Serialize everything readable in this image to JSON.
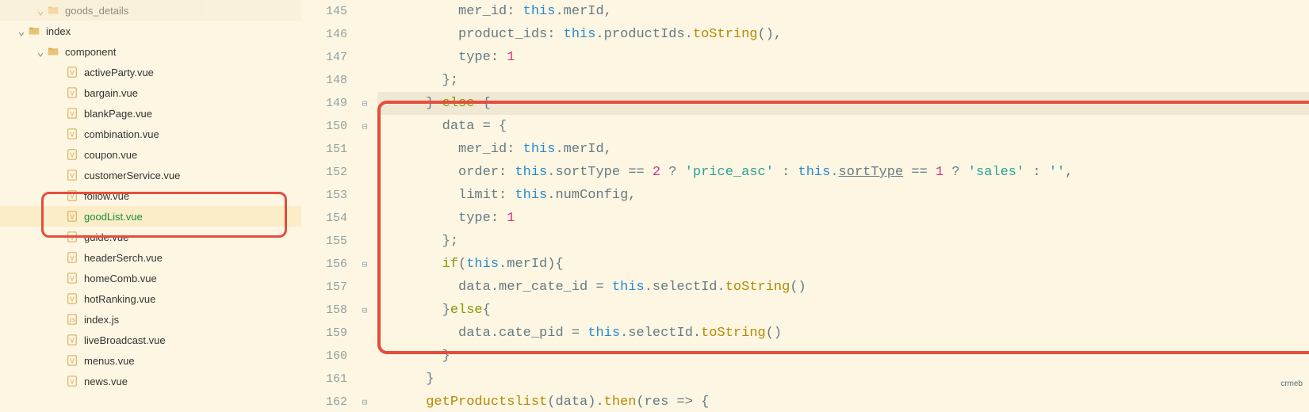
{
  "tree": [
    {
      "label": "goods_details",
      "type": "folder",
      "indent": 2,
      "expanded": true,
      "dim": true
    },
    {
      "label": "index",
      "type": "folder",
      "indent": 1,
      "expanded": true
    },
    {
      "label": "component",
      "type": "folder",
      "indent": 2,
      "expanded": true
    },
    {
      "label": "activeParty.vue",
      "type": "vue",
      "indent": 3
    },
    {
      "label": "bargain.vue",
      "type": "vue",
      "indent": 3
    },
    {
      "label": "blankPage.vue",
      "type": "vue",
      "indent": 3
    },
    {
      "label": "combination.vue",
      "type": "vue",
      "indent": 3
    },
    {
      "label": "coupon.vue",
      "type": "vue",
      "indent": 3
    },
    {
      "label": "customerService.vue",
      "type": "vue",
      "indent": 3
    },
    {
      "label": "follow.vue",
      "type": "vue",
      "indent": 3
    },
    {
      "label": "goodList.vue",
      "type": "vue",
      "indent": 3,
      "selected": true
    },
    {
      "label": "guide.vue",
      "type": "vue",
      "indent": 3
    },
    {
      "label": "headerSerch.vue",
      "type": "vue",
      "indent": 3
    },
    {
      "label": "homeComb.vue",
      "type": "vue",
      "indent": 3
    },
    {
      "label": "hotRanking.vue",
      "type": "vue",
      "indent": 3
    },
    {
      "label": "index.js",
      "type": "js",
      "indent": 3
    },
    {
      "label": "liveBroadcast.vue",
      "type": "vue",
      "indent": 3
    },
    {
      "label": "menus.vue",
      "type": "vue",
      "indent": 3
    },
    {
      "label": "news.vue",
      "type": "vue",
      "indent": 3
    }
  ],
  "lines": {
    "start": 145,
    "rows": [
      {
        "n": 145,
        "fold": "",
        "hl": false
      },
      {
        "n": 146,
        "fold": "",
        "hl": false
      },
      {
        "n": 147,
        "fold": "",
        "hl": false
      },
      {
        "n": 148,
        "fold": "",
        "hl": false
      },
      {
        "n": 149,
        "fold": "⊟",
        "hl": true
      },
      {
        "n": 150,
        "fold": "⊟",
        "hl": false
      },
      {
        "n": 151,
        "fold": "",
        "hl": false
      },
      {
        "n": 152,
        "fold": "",
        "hl": false
      },
      {
        "n": 153,
        "fold": "",
        "hl": false
      },
      {
        "n": 154,
        "fold": "",
        "hl": false
      },
      {
        "n": 155,
        "fold": "",
        "hl": false
      },
      {
        "n": 156,
        "fold": "⊟",
        "hl": false
      },
      {
        "n": 157,
        "fold": "",
        "hl": false
      },
      {
        "n": 158,
        "fold": "⊟",
        "hl": false
      },
      {
        "n": 159,
        "fold": "",
        "hl": false
      },
      {
        "n": 160,
        "fold": "",
        "hl": false
      },
      {
        "n": 161,
        "fold": "",
        "hl": false
      },
      {
        "n": 162,
        "fold": "⊟",
        "hl": false
      }
    ]
  },
  "code": {
    "l145_pad": "          ",
    "l145_key": "mer_id: ",
    "l145_this": "this",
    "l145_rest": ".merId,",
    "l146_pad": "          ",
    "l146_key": "product_ids: ",
    "l146_this": "this",
    "l146_mid": ".productIds.",
    "l146_fn": "toString",
    "l146_end": "(),",
    "l147_pad": "          ",
    "l147_key": "type: ",
    "l147_num": "1",
    "l148_pad": "        ",
    "l148_t": "};",
    "l149_pad": "      ",
    "l149_brace": "} ",
    "l149_else": "else",
    "l149_brace2": " {",
    "l150_pad": "        ",
    "l150_t": "data = {",
    "l151_pad": "          ",
    "l151_key": "mer_id: ",
    "l151_this": "this",
    "l151_rest": ".merId,",
    "l152_pad": "          ",
    "l152_key": "order: ",
    "l152_this1": "this",
    "l152_m1": ".sortType == ",
    "l152_n1": "2",
    "l152_m2": " ? ",
    "l152_s1": "'price_asc'",
    "l152_m3": " : ",
    "l152_this2": "this",
    "l152_m4": ".",
    "l152_u": "sortType",
    "l152_m5": " == ",
    "l152_n2": "1",
    "l152_m6": " ? ",
    "l152_s2": "'sales'",
    "l152_m7": " : ",
    "l152_s3": "''",
    "l152_m8": ",",
    "l153_pad": "          ",
    "l153_key": "limit: ",
    "l153_this": "this",
    "l153_rest": ".numConfig,",
    "l154_pad": "          ",
    "l154_key": "type: ",
    "l154_num": "1",
    "l155_pad": "        ",
    "l155_t": "};",
    "l156_pad": "        ",
    "l156_if": "if",
    "l156_p1": "(",
    "l156_this": "this",
    "l156_rest": ".merId){",
    "l157_pad": "          ",
    "l157_a": "data.mer_cate_id = ",
    "l157_this": "this",
    "l157_m": ".selectId.",
    "l157_fn": "toString",
    "l157_end": "()",
    "l158_pad": "        ",
    "l158_b": "}",
    "l158_else": "else",
    "l158_b2": "{",
    "l159_pad": "          ",
    "l159_a": "data.cate_pid = ",
    "l159_this": "this",
    "l159_m": ".selectId.",
    "l159_fn": "toString",
    "l159_end": "()",
    "l160_pad": "        ",
    "l160_t": "}",
    "l161_pad": "      ",
    "l161_t": "}",
    "l162_pad": "      ",
    "l162_fn": "getProductslist",
    "l162_m1": "(data).",
    "l162_then": "then",
    "l162_m2": "(res => {"
  },
  "watermark": "crmeb"
}
